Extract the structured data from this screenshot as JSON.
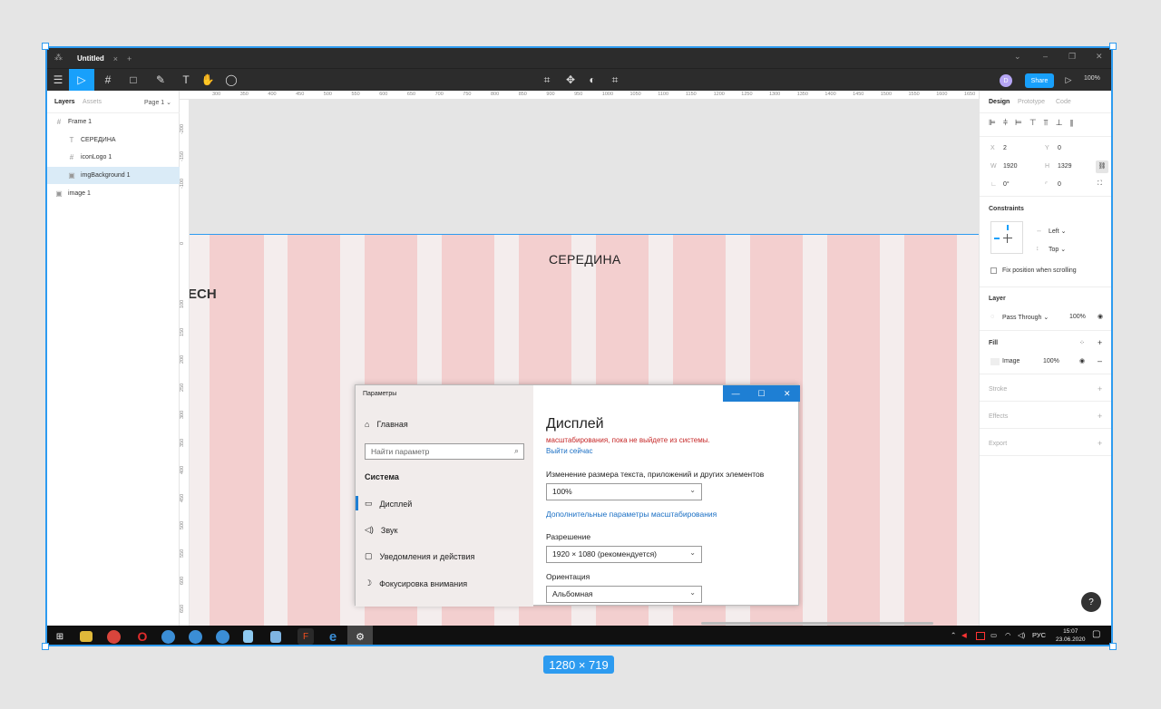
{
  "app": {
    "tab_title": "Untitled",
    "tab_close": "×",
    "tab_add": "+",
    "share_label": "Share",
    "avatar_initial": "D",
    "zoom": "100%"
  },
  "toolbar": {
    "menu_glyph": "☰",
    "move_glyph": "▷",
    "frame_glyph": "#",
    "shape_glyph": "□",
    "pen_glyph": "✎",
    "text_glyph": "T",
    "hand_glyph": "✋",
    "comment_glyph": "◯",
    "play_glyph": "▷"
  },
  "left_panel": {
    "tabs": [
      "Layers",
      "Assets"
    ],
    "page": "Page 1 ⌄",
    "layers": [
      {
        "name": "Frame 1",
        "icon": "frame-icon",
        "glyph": "#"
      },
      {
        "name": "СЕРЕДИНА",
        "icon": "text-icon",
        "glyph": "T"
      },
      {
        "name": "iconLogo 1",
        "icon": "frame-icon",
        "glyph": "#"
      },
      {
        "name": "imgBackground 1",
        "icon": "image-icon",
        "glyph": "▣"
      },
      {
        "name": "image 1",
        "icon": "image-icon",
        "glyph": "▣"
      }
    ]
  },
  "rulers": {
    "top": [
      "300",
      "350",
      "400",
      "450",
      "500",
      "550",
      "600",
      "650",
      "700",
      "750",
      "800",
      "850",
      "900",
      "950",
      "1000",
      "1050",
      "1100",
      "1150",
      "1200",
      "1250",
      "1300",
      "1350",
      "1400",
      "1450",
      "1500",
      "1550",
      "1600",
      "1650"
    ],
    "left_upper": [
      "-200",
      "-150",
      "-100",
      "0"
    ],
    "left_lower": [
      "100",
      "150",
      "200",
      "250",
      "300",
      "350",
      "400",
      "450",
      "500",
      "550",
      "600",
      "650",
      "700"
    ]
  },
  "canvas": {
    "frame_heading": "СЕРЕДИНА",
    "cropped_text": "ECH"
  },
  "settings_window": {
    "title": "Параметры",
    "controls": [
      "—",
      "☐",
      "✕"
    ],
    "home": "Главная",
    "search_placeholder": "Найти параметр",
    "section": "Система",
    "nav": [
      {
        "label": "Дисплей",
        "icon": "display-icon",
        "glyph": "▭"
      },
      {
        "label": "Звук",
        "icon": "sound-icon",
        "glyph": "🔊"
      },
      {
        "label": "Уведомления и действия",
        "icon": "notifications-icon",
        "glyph": "▢"
      },
      {
        "label": "Фокусировка внимания",
        "icon": "focus-icon",
        "glyph": "☽"
      }
    ],
    "heading": "Дисплей",
    "warning": "масштабирования, пока не выйдете из системы.",
    "signout_link": "Выйти сейчас",
    "scale_label": "Изменение размера текста, приложений и других элементов",
    "scale_value": "100%",
    "advanced_link": "Дополнительные параметры масштабирования",
    "resolution_label": "Разрешение",
    "resolution_value": "1920 × 1080 (рекомендуется)",
    "orientation_label": "Ориентация",
    "orientation_value": "Альбомная"
  },
  "right_panel": {
    "tabs": [
      "Design",
      "Prototype",
      "Code"
    ],
    "x_label": "X",
    "x_value": "2",
    "y_label": "Y",
    "y_value": "0",
    "w_label": "W",
    "w_value": "1920",
    "h_label": "H",
    "h_value": "1329",
    "rotation": "0°",
    "radius": "0",
    "constraints_title": "Constraints",
    "constraint_h": "Left ⌄",
    "constraint_v": "Top ⌄",
    "fix_position": "Fix position when scrolling",
    "layer_title": "Layer",
    "blend": "Pass Through ⌄",
    "layer_opacity": "100%",
    "fill_title": "Fill",
    "fill_type": "Image",
    "fill_opacity": "100%",
    "stroke_title": "Stroke",
    "effects_title": "Effects",
    "export_title": "Export"
  },
  "taskbar": {
    "lang": "РУС",
    "time": "15:07",
    "date": "23.06.2020"
  },
  "selection_size": "1280 × 719",
  "help": "?"
}
